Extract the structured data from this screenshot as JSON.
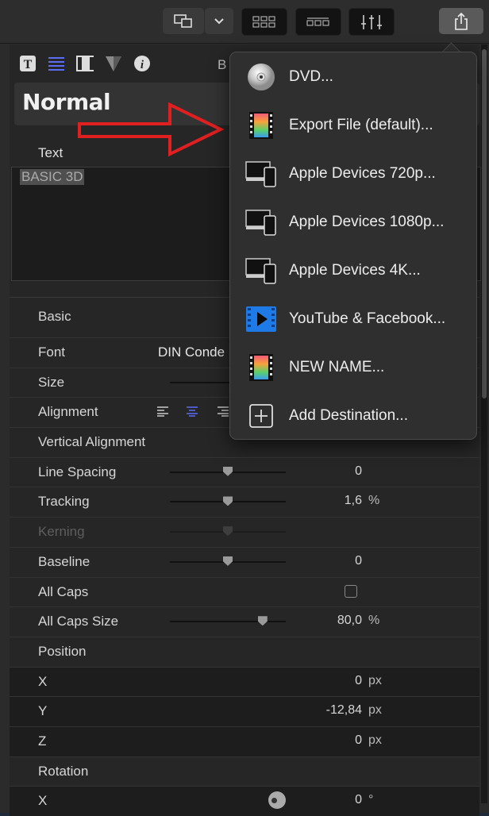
{
  "inspector": {
    "tab_partial_label": "B",
    "preset_name": "Normal",
    "text_section_label": "Text",
    "text_content": "BASIC 3D",
    "basic_label": "Basic",
    "font_label": "Font",
    "font_value": "DIN Conde",
    "size_label": "Size",
    "alignment_label": "Alignment",
    "vertical_alignment_label": "Vertical Alignment",
    "line_spacing_label": "Line Spacing",
    "line_spacing_value": "0",
    "tracking_label": "Tracking",
    "tracking_value": "1,6",
    "tracking_unit": "%",
    "kerning_label": "Kerning",
    "baseline_label": "Baseline",
    "baseline_value": "0",
    "all_caps_label": "All Caps",
    "all_caps_size_label": "All Caps Size",
    "all_caps_size_value": "80,0",
    "all_caps_size_unit": "%",
    "position_label": "Position",
    "pos_x_label": "X",
    "pos_x_value": "0",
    "pos_y_label": "Y",
    "pos_y_value": "-12,84",
    "pos_z_label": "Z",
    "pos_z_value": "0",
    "px_unit": "px",
    "rotation_label": "Rotation",
    "rot_x_label": "X",
    "rot_x_value": "0",
    "rot_unit": "°"
  },
  "sliders": {
    "line_spacing": 0.5,
    "tracking": 0.5,
    "kerning": 0.5,
    "baseline": 0.5,
    "all_caps_size": 0.8
  },
  "share_menu": {
    "items": [
      {
        "label": "DVD...",
        "icon": "dvd-icon"
      },
      {
        "label": "Export File (default)...",
        "icon": "film-frame-icon"
      },
      {
        "label": "Apple Devices 720p...",
        "icon": "apple-devices-icon"
      },
      {
        "label": "Apple Devices 1080p...",
        "icon": "apple-devices-icon"
      },
      {
        "label": "Apple Devices 4K...",
        "icon": "apple-devices-icon"
      },
      {
        "label": "YouTube & Facebook...",
        "icon": "youtube-facebook-icon"
      },
      {
        "label": "NEW NAME...",
        "icon": "film-frame-icon"
      },
      {
        "label": "Add Destination...",
        "icon": "plus-square-icon"
      }
    ]
  },
  "colors": {
    "accent_blue": "#5b6cf5",
    "annotation_red": "#e02020",
    "youtube_blue": "#1e7ae6"
  }
}
